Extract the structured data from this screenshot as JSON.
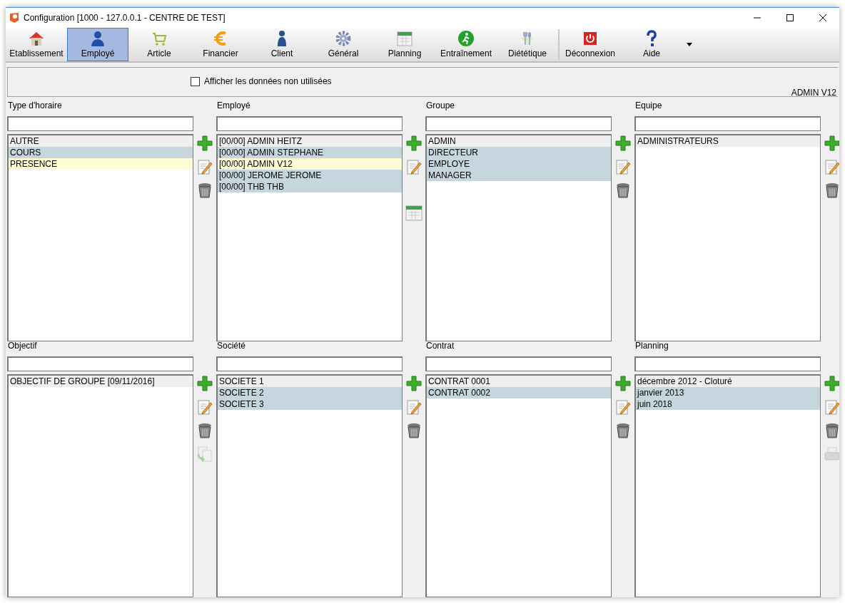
{
  "window": {
    "title": "Configuration [1000 - 127.0.0.1 - CENTRE DE TEST]"
  },
  "toolbar": [
    {
      "label": "Etablissement",
      "selected": false,
      "separator_before": false
    },
    {
      "label": "Employé",
      "selected": true,
      "separator_before": false
    },
    {
      "label": "Article",
      "selected": false,
      "separator_before": false
    },
    {
      "label": "Financier",
      "selected": false,
      "separator_before": false
    },
    {
      "label": "Client",
      "selected": false,
      "separator_before": false
    },
    {
      "label": "Général",
      "selected": false,
      "separator_before": false
    },
    {
      "label": "Planning",
      "selected": false,
      "separator_before": false
    },
    {
      "label": "Entraînement",
      "selected": false,
      "separator_before": false
    },
    {
      "label": "Diététique",
      "selected": false,
      "separator_before": false
    },
    {
      "label": "Déconnexion",
      "selected": false,
      "separator_before": true
    },
    {
      "label": "Aide",
      "selected": false,
      "separator_before": false
    }
  ],
  "options": {
    "label": "Afficher les données non utilisées",
    "checked": false
  },
  "user": "ADMIN V12",
  "panels": [
    {
      "title": "Type d'horaire",
      "rows": [
        {
          "text": "AUTRE",
          "selected": false,
          "current": true,
          "hovered": false
        },
        {
          "text": "COURS",
          "selected": true,
          "current": false,
          "hovered": false
        },
        {
          "text": "PRESENCE",
          "selected": false,
          "current": false,
          "hovered": true
        }
      ],
      "tools": [
        {
          "kind": "add",
          "disabled": false
        },
        {
          "kind": "edit",
          "disabled": false
        },
        {
          "kind": "delete",
          "disabled": false
        }
      ]
    },
    {
      "title": "Employé",
      "rows": [
        {
          "text": "[00/00] ADMIN HEITZ",
          "selected": false,
          "current": true,
          "hovered": false
        },
        {
          "text": "[00/00] ADMIN STEPHANE",
          "selected": true,
          "current": false,
          "hovered": false
        },
        {
          "text": "[00/00] ADMIN V12",
          "selected": false,
          "current": false,
          "hovered": true
        },
        {
          "text": "[00/00] JEROME JEROME",
          "selected": true,
          "current": false,
          "hovered": false
        },
        {
          "text": "[00/00] THB THB",
          "selected": true,
          "current": false,
          "hovered": false
        }
      ],
      "tools": [
        {
          "kind": "add",
          "disabled": false
        },
        {
          "kind": "edit",
          "disabled": false
        },
        {
          "kind": "calendar",
          "disabled": false
        }
      ]
    },
    {
      "title": "Groupe",
      "rows": [
        {
          "text": "ADMIN",
          "selected": false,
          "current": true,
          "hovered": false
        },
        {
          "text": "DIRECTEUR",
          "selected": true,
          "current": false,
          "hovered": false
        },
        {
          "text": "EMPLOYE",
          "selected": true,
          "current": false,
          "hovered": false
        },
        {
          "text": "MANAGER",
          "selected": true,
          "current": false,
          "hovered": false
        }
      ],
      "tools": [
        {
          "kind": "add",
          "disabled": false
        },
        {
          "kind": "edit",
          "disabled": false
        },
        {
          "kind": "delete",
          "disabled": false
        }
      ]
    },
    {
      "title": "Equipe",
      "rows": [
        {
          "text": "ADMINISTRATEURS",
          "selected": false,
          "current": true,
          "hovered": false
        }
      ],
      "tools": [
        {
          "kind": "add",
          "disabled": false
        },
        {
          "kind": "edit",
          "disabled": false
        },
        {
          "kind": "delete",
          "disabled": false
        }
      ]
    },
    {
      "title": "Objectif",
      "rows": [
        {
          "text": "OBJECTIF DE GROUPE [09/11/2016]",
          "selected": false,
          "current": true,
          "hovered": false
        }
      ],
      "tools": [
        {
          "kind": "add",
          "disabled": false
        },
        {
          "kind": "edit",
          "disabled": false
        },
        {
          "kind": "delete",
          "disabled": false
        },
        {
          "kind": "copy",
          "disabled": true
        }
      ]
    },
    {
      "title": "Société",
      "rows": [
        {
          "text": "SOCIETE 1",
          "selected": false,
          "current": true,
          "hovered": false
        },
        {
          "text": "SOCIETE 2",
          "selected": true,
          "current": false,
          "hovered": false
        },
        {
          "text": "SOCIETE 3",
          "selected": true,
          "current": false,
          "hovered": false
        }
      ],
      "tools": [
        {
          "kind": "add",
          "disabled": false
        },
        {
          "kind": "edit",
          "disabled": false
        },
        {
          "kind": "delete",
          "disabled": false
        }
      ]
    },
    {
      "title": "Contrat",
      "rows": [
        {
          "text": "CONTRAT 0001",
          "selected": false,
          "current": true,
          "hovered": false
        },
        {
          "text": "CONTRAT 0002",
          "selected": true,
          "current": false,
          "hovered": false
        }
      ],
      "tools": [
        {
          "kind": "add",
          "disabled": false
        },
        {
          "kind": "edit",
          "disabled": false
        },
        {
          "kind": "delete",
          "disabled": false
        }
      ]
    },
    {
      "title": "Planning",
      "rows": [
        {
          "text": "décembre 2012 - Cloturé",
          "selected": false,
          "current": true,
          "hovered": false
        },
        {
          "text": "janvier 2013",
          "selected": true,
          "current": false,
          "hovered": false
        },
        {
          "text": "juin 2018",
          "selected": true,
          "current": false,
          "hovered": false
        }
      ],
      "tools": [
        {
          "kind": "add",
          "disabled": false
        },
        {
          "kind": "edit",
          "disabled": false
        },
        {
          "kind": "delete",
          "disabled": false
        },
        {
          "kind": "print",
          "disabled": true
        }
      ]
    }
  ]
}
